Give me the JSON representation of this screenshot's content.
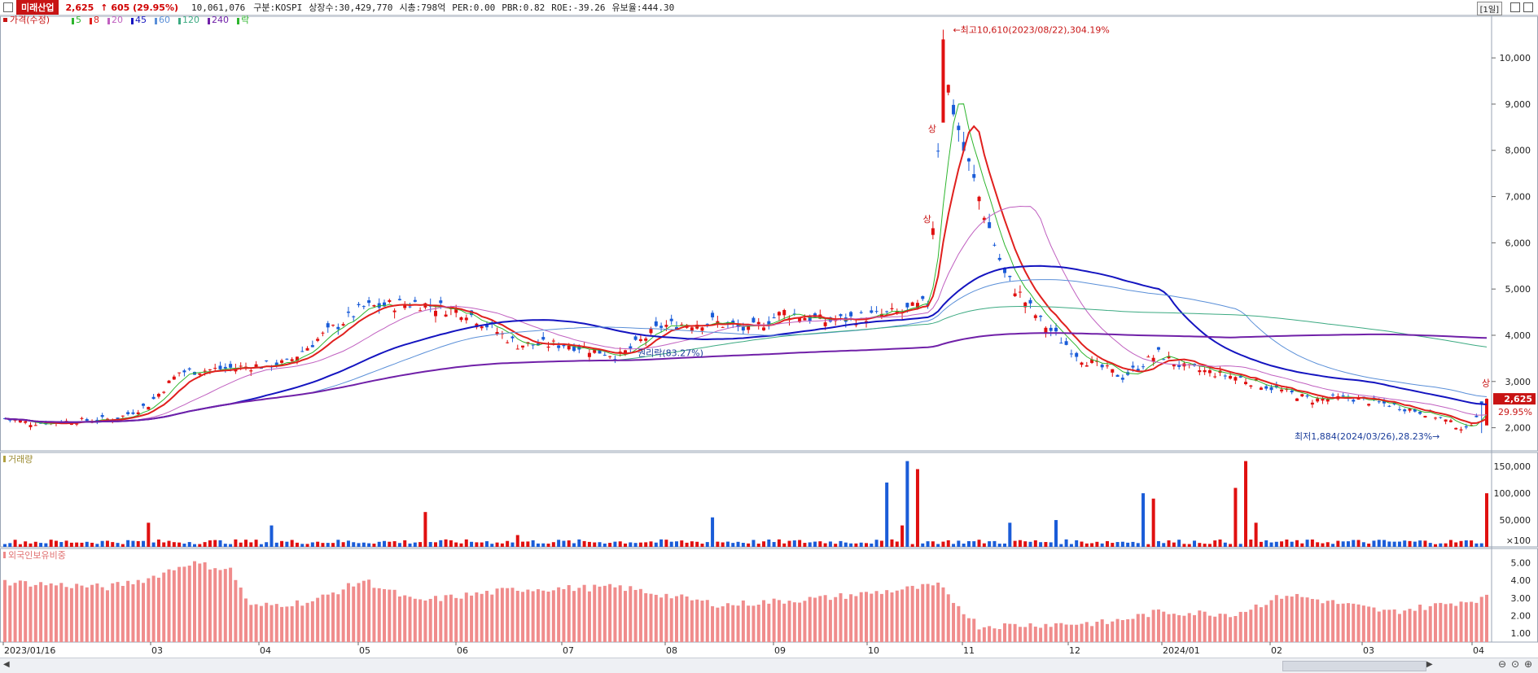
{
  "header": {
    "stock_name": "미래산업",
    "price": "2,625",
    "change": "↑ 605  (29.95%)",
    "volume": "10,061,076",
    "market": "구분:KOSPI",
    "listed_shares": "상장수:30,429,770",
    "market_cap": "시총:798억",
    "per": "PER:0.00",
    "pbr": "PBR:0.82",
    "roe": "ROE:-39.26",
    "float_ratio": "유보율:444.30",
    "period": "[1일]"
  },
  "legend": {
    "price_title": "가격(수정)",
    "ma_items": [
      {
        "label": "5",
        "color": "#2db52d"
      },
      {
        "label": "8",
        "color": "#e0201e"
      },
      {
        "label": "20",
        "color": "#c060c0"
      },
      {
        "label": "45",
        "color": "#1414c0"
      },
      {
        "label": "60",
        "color": "#5a8fd8"
      },
      {
        "label": "120",
        "color": "#3caa82"
      },
      {
        "label": "240",
        "color": "#7020a8"
      },
      {
        "label": "락",
        "color": "#2db52d"
      }
    ],
    "volume_title": "거래량",
    "foreign_title": "외국인보유비중"
  },
  "annotations": {
    "high": "최고10,610(2023/08/22),304.19%",
    "low": "최저1,884(2024/03/26),28.23%",
    "rights": "권리락(83.27%)",
    "limit_up": "상",
    "last_price_tag": "2,625",
    "last_pct_tag": "29.95%"
  },
  "chart_data": {
    "type": "candlestick",
    "x_labels": [
      "2023/01/16",
      "03",
      "04",
      "05",
      "06",
      "07",
      "08",
      "09",
      "10",
      "11",
      "12",
      "2024/01",
      "02",
      "03",
      "04"
    ],
    "price_panel": {
      "y_ticks": [
        "2,000",
        "3,000",
        "4,000",
        "5,000",
        "6,000",
        "7,000",
        "8,000",
        "9,000",
        "10,000"
      ],
      "ylim": [
        1500,
        10900
      ],
      "candles_approx": [
        {
          "period": "2023/01",
          "close": 2150
        },
        {
          "period": "2023/03",
          "close": 3300
        },
        {
          "period": "2023/04",
          "close": 3600
        },
        {
          "period": "2023/05",
          "close": 4600
        },
        {
          "period": "2023/06",
          "close": 3700
        },
        {
          "period": "2023/07",
          "close": 4300
        },
        {
          "period": "2023/08 early",
          "close": 4400
        },
        {
          "period": "2023/08/22",
          "high": 10610
        },
        {
          "period": "2023/09",
          "close": 4500
        },
        {
          "period": "2023/10",
          "close": 3200
        },
        {
          "period": "2023/11",
          "close": 3000
        },
        {
          "period": "2023/12",
          "close": 2500
        },
        {
          "period": "2024/01",
          "close": 2650
        },
        {
          "period": "2024/02",
          "close": 2300
        },
        {
          "period": "2024/03/26",
          "low": 1884
        },
        {
          "period": "last",
          "close": 2625
        }
      ]
    },
    "volume_panel": {
      "y_ticks": [
        "150,000",
        "100,000",
        "50,000",
        "×100"
      ]
    },
    "foreign_panel": {
      "y_ticks": [
        "5.00",
        "4.00",
        "3.00",
        "2.00",
        "1.00"
      ],
      "ylim": [
        0.5,
        5.8
      ]
    }
  }
}
